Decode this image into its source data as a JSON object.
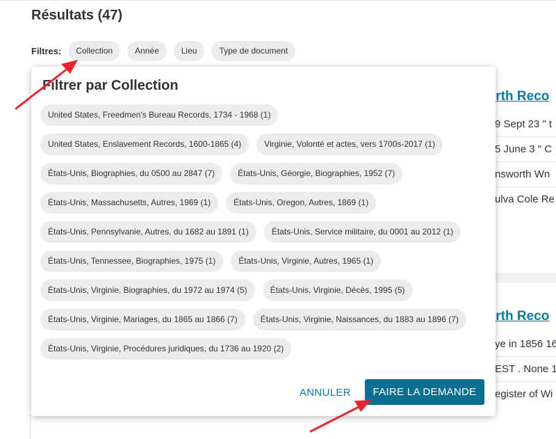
{
  "page": {
    "title": "Résultats (47)",
    "filters_label": "Filtres:",
    "filters": [
      "Collection",
      "Année",
      "Lieu",
      "Type de document"
    ]
  },
  "background_results": {
    "cards": [
      {
        "title": "irth Reco",
        "lines": [
          "9 Sept 23 \" t",
          "5 June 3 \" C",
          "nsworth Wn",
          "ulva Cole Re"
        ]
      },
      {
        "title": "irth Reco",
        "lines": [
          "ye in 1856 16",
          "EST . None 1",
          "egister of Wi"
        ]
      }
    ]
  },
  "modal": {
    "title": "Filtrer par Collection",
    "options": [
      "United States, Freedmen's Bureau Records, 1734 - 1968 (1)",
      "United States, Enslavement Records, 1600-1865 (4)",
      "Virginie, Volonté et actes, vers 1700s-2017 (1)",
      "États-Unis, Biographies, du 0500 au 2847 (7)",
      "États-Unis, Géorgie, Biographies, 1952 (7)",
      "États-Unis, Massachusetts, Autres, 1969 (1)",
      "États-Unis, Oregon, Autres, 1869 (1)",
      "États-Unis, Pennsylvanie, Autres, du 1682 au 1891 (1)",
      "États-Unis, Service militaire, du 0001 au 2012 (1)",
      "États-Unis, Tennessee, Biographies, 1975 (1)",
      "États-Unis, Virginie, Autres, 1965 (1)",
      "États-Unis, Virginie, Biographies, du 1972 au 1974 (5)",
      "États-Unis, Virginie, Décès, 1995 (5)",
      "États-Unis, Virginie, Mariages, du 1865 au 1866 (7)",
      "États-Unis, Virginie, Naissances, du 1883 au 1896 (7)",
      "États-Unis, Virginie, Procédures juridiques, du 1736 au 1920 (2)"
    ],
    "cancel_label": "ANNULER",
    "submit_label": "FAIRE LA DEMANDE"
  },
  "colors": {
    "link": "#0a7a9e",
    "primary_button": "#0a6f90",
    "chip_bg": "#ececec",
    "annotation_arrow": "#e8262b"
  }
}
